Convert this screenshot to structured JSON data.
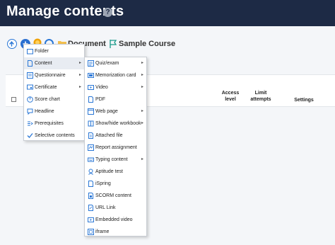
{
  "header": {
    "title": "Manage contents",
    "help_symbol": "?"
  },
  "breadcrumb": {
    "folder": "Document",
    "separator": "›",
    "course": "Sample Course"
  },
  "table": {
    "headers": [
      {
        "line1": "Access",
        "line2": "level"
      },
      {
        "line1": "Limit",
        "line2": "attempts"
      },
      {
        "line1": "Settings",
        "line2": ""
      }
    ]
  },
  "add_menu": {
    "items": [
      {
        "label": "Folder",
        "icon": "folder-icon",
        "has_submenu": false
      },
      {
        "label": "Content",
        "icon": "document-icon",
        "has_submenu": true,
        "active": true
      },
      {
        "label": "Questionnaire",
        "icon": "questionnaire-icon",
        "has_submenu": true
      },
      {
        "label": "Certificate",
        "icon": "certificate-icon",
        "has_submenu": true
      },
      {
        "label": "Score chart",
        "icon": "chart-icon",
        "has_submenu": false
      },
      {
        "label": "Headline",
        "icon": "headline-icon",
        "has_submenu": false
      },
      {
        "label": "Prerequisites",
        "icon": "prerequisites-icon",
        "has_submenu": false
      },
      {
        "label": "Selective contents",
        "icon": "checkmark-icon",
        "has_submenu": false
      }
    ]
  },
  "content_submenu": {
    "items": [
      {
        "label": "Quiz/exam",
        "icon": "quiz-icon",
        "has_submenu": true
      },
      {
        "label": "Memorization card",
        "icon": "card-icon",
        "has_submenu": true
      },
      {
        "label": "Video",
        "icon": "video-icon",
        "has_submenu": true
      },
      {
        "label": "PDF",
        "icon": "pdf-icon",
        "has_submenu": false
      },
      {
        "label": "Web page",
        "icon": "web-page-icon",
        "has_submenu": true
      },
      {
        "label": "Show/hide workbook",
        "icon": "workbook-icon",
        "has_submenu": true
      },
      {
        "label": "Attached file",
        "icon": "attachment-icon",
        "has_submenu": false
      },
      {
        "label": "Report assignment",
        "icon": "report-icon",
        "has_submenu": false
      },
      {
        "label": "Typing content",
        "icon": "typing-icon",
        "has_submenu": true
      },
      {
        "label": "Aptitude test",
        "icon": "aptitude-icon",
        "has_submenu": false
      },
      {
        "label": "iSpring",
        "icon": "ispring-icon",
        "has_submenu": false
      },
      {
        "label": "SCORM content",
        "icon": "scorm-icon",
        "has_submenu": false
      },
      {
        "label": "URL Link",
        "icon": "link-icon",
        "has_submenu": false
      },
      {
        "label": "Embedded video",
        "icon": "embedded-video-icon",
        "has_submenu": false
      },
      {
        "label": "iframe",
        "icon": "iframe-icon",
        "has_submenu": false
      }
    ]
  },
  "colors": {
    "header_bg": "#1d2a45",
    "accent": "#2a77d6",
    "menu_active_bg": "#e8ecf2",
    "medal": "#f0a30a"
  }
}
